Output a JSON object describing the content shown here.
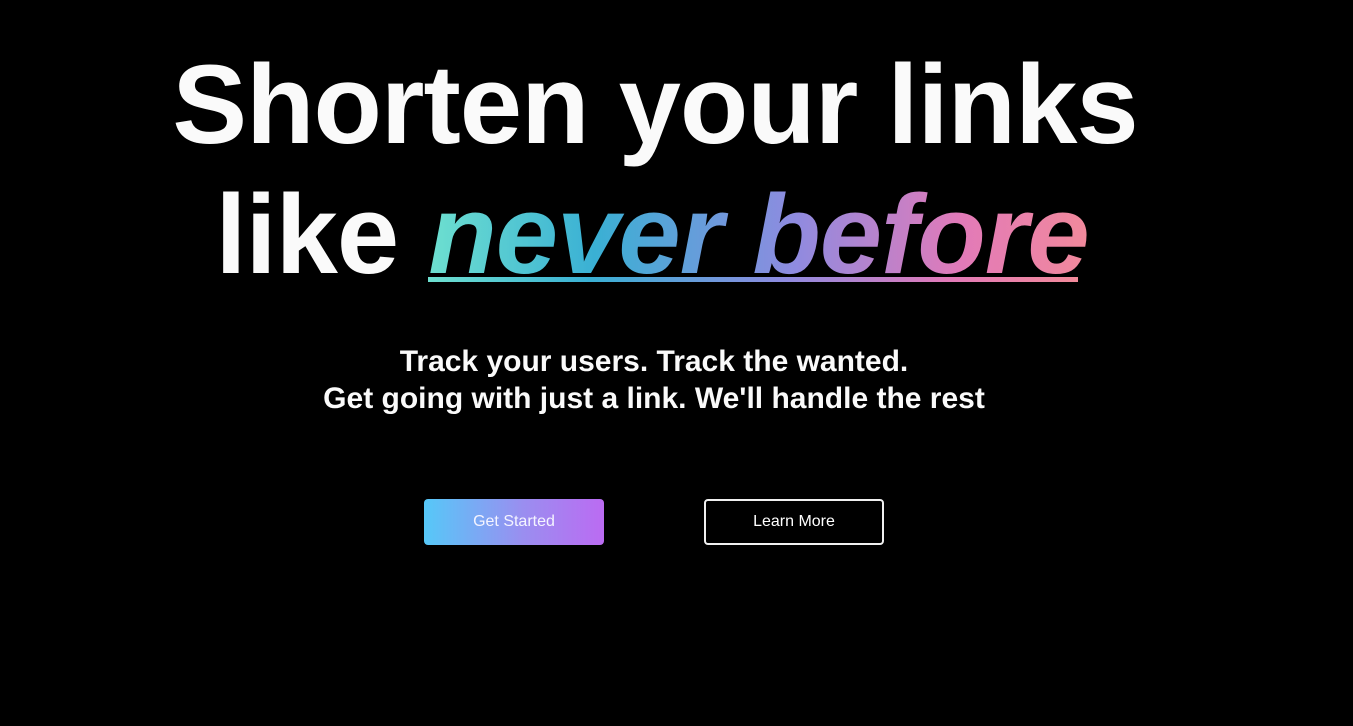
{
  "hero": {
    "headline_line1": "Shorten your links",
    "headline_line2_prefix": "like ",
    "headline_highlight": "never before",
    "subtitle_line1": "Track your users. Track the wanted.",
    "subtitle_line2": "Get going with just a link. We'll handle the rest"
  },
  "actions": {
    "primary_label": "Get Started",
    "secondary_label": "Learn More"
  },
  "colors": {
    "background": "#000000",
    "text": "#fafafa",
    "gradient_start": "#6ee0d0",
    "gradient_mid": "#8f8be0",
    "gradient_end": "#f28a9a",
    "button_gradient_start": "#56c8f8",
    "button_gradient_end": "#bb6bf2"
  }
}
